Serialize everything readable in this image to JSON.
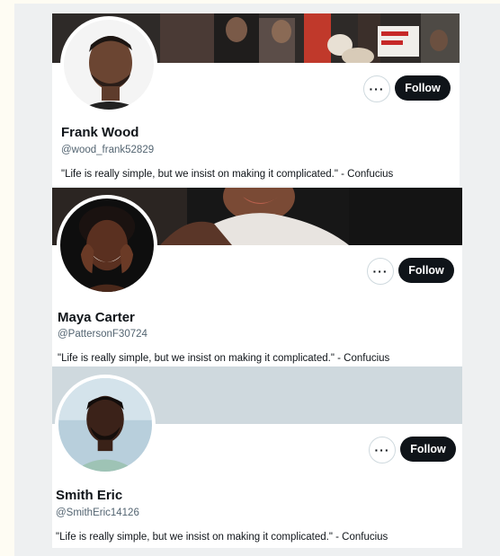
{
  "profiles": [
    {
      "name": "Frank Wood",
      "handle": "@wood_frank52829",
      "bio": "\"Life is really simple, but we insist on making it complicated.\" - Confucius",
      "more_label": "···",
      "follow_label": "Follow",
      "banner_style": "protest-crowd-photo"
    },
    {
      "name": "Maya Carter",
      "handle": "@PattersonF30724",
      "bio": "\"Life is really simple, but we insist on making it complicated.\" - Confucius",
      "more_label": "···",
      "follow_label": "Follow",
      "banner_style": "portrait-closeup-photo"
    },
    {
      "name": "Smith Eric",
      "handle": "@SmithEric14126",
      "bio": "\"Life is really simple, but we insist on making it complicated.\" - Confucius",
      "more_label": "···",
      "follow_label": "Follow",
      "banner_style": "solid-gray"
    }
  ],
  "colors": {
    "follow_button": "#0f1419",
    "handle_text": "#536471",
    "placeholder_banner": "#cfd9de",
    "page_background": "#eef0f1"
  }
}
